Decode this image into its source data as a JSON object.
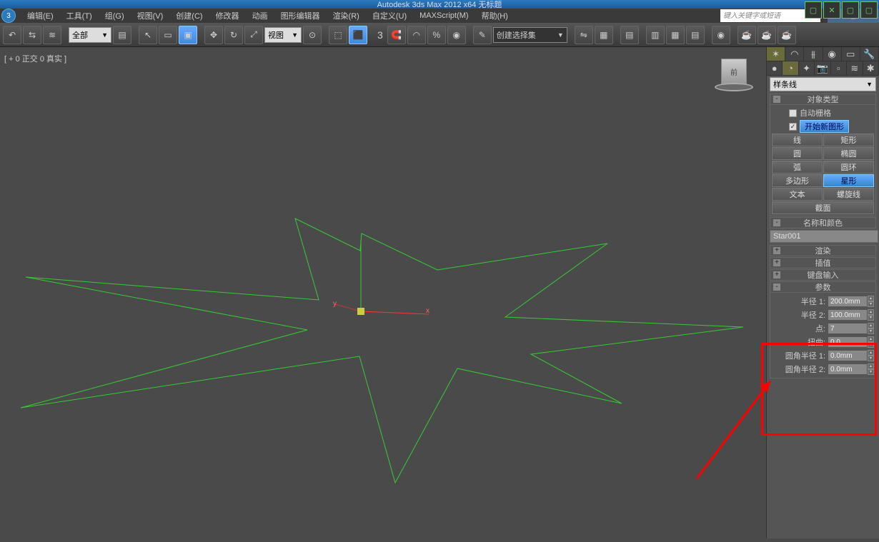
{
  "title": "Autodesk 3ds Max 2012 x64   无标题",
  "search_placeholder": "键入关键字或短语",
  "menus": [
    "编辑(E)",
    "工具(T)",
    "组(G)",
    "视图(V)",
    "创建(C)",
    "修改器",
    "动画",
    "图形编辑器",
    "渲染(R)",
    "自定义(U)",
    "MAXScript(M)",
    "帮助(H)"
  ],
  "toolbar": {
    "filter_combo": "全部",
    "view_combo": "视图",
    "nameset_combo": "创建选择集"
  },
  "viewport_label": "[ + 0 正交 0 真实 ]",
  "viewcube_face": "前",
  "right": {
    "category_combo": "样条线",
    "rollouts": {
      "object_type": "对象类型",
      "auto_grid": "自动栅格",
      "start_new": "开始新图形",
      "name_color": "名称和颜色",
      "render": "渲染",
      "interp": "插值",
      "keyboard": "键盘输入",
      "params": "参数"
    },
    "shapes": {
      "line": "线",
      "rect": "矩形",
      "circle": "圆",
      "ellipse": "椭圆",
      "arc": "弧",
      "donut": "圆环",
      "ngon": "多边形",
      "star": "星形",
      "text": "文本",
      "helix": "螺旋线",
      "section": "截面"
    },
    "object_name": "Star001",
    "params": {
      "radius1_label": "半径 1:",
      "radius1": "200.0mm",
      "radius2_label": "半径 2:",
      "radius2": "100.0mm",
      "points_label": "点:",
      "points": "7",
      "distortion_label": "扭曲:",
      "distortion": "0.0",
      "fillet1_label": "圆角半径 1:",
      "fillet1": "0.0mm",
      "fillet2_label": "圆角半径 2:",
      "fillet2": "0.0mm"
    }
  }
}
